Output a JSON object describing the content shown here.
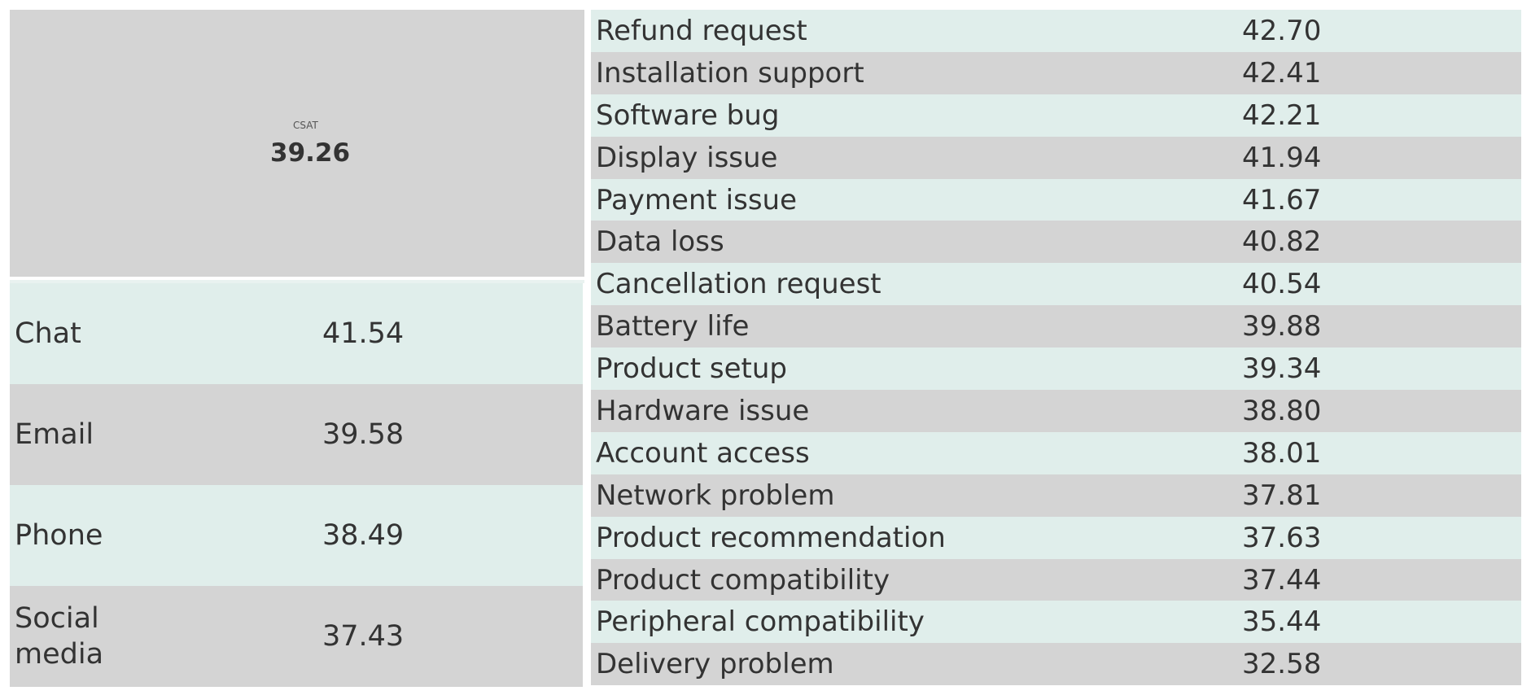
{
  "kpi": {
    "label": "CSAT",
    "value": "39.26"
  },
  "channels": [
    {
      "name": "Chat",
      "value": "41.54"
    },
    {
      "name": "Email",
      "value": "39.58"
    },
    {
      "name": "Phone",
      "value": "38.49"
    },
    {
      "name": "Social media",
      "value": "37.43"
    }
  ],
  "issues": [
    {
      "name": "Refund request",
      "value": "42.70"
    },
    {
      "name": "Installation support",
      "value": "42.41"
    },
    {
      "name": "Software bug",
      "value": "42.21"
    },
    {
      "name": "Display issue",
      "value": "41.94"
    },
    {
      "name": "Payment issue",
      "value": "41.67"
    },
    {
      "name": "Data loss",
      "value": "40.82"
    },
    {
      "name": "Cancellation request",
      "value": "40.54"
    },
    {
      "name": "Battery life",
      "value": "39.88"
    },
    {
      "name": "Product setup",
      "value": "39.34"
    },
    {
      "name": "Hardware issue",
      "value": "38.80"
    },
    {
      "name": "Account access",
      "value": "38.01"
    },
    {
      "name": "Network problem",
      "value": "37.81"
    },
    {
      "name": "Product recommendation",
      "value": "37.63"
    },
    {
      "name": "Product compatibility",
      "value": "37.44"
    },
    {
      "name": "Peripheral compatibility",
      "value": "35.44"
    },
    {
      "name": "Delivery problem",
      "value": "32.58"
    }
  ],
  "colors": {
    "row_teal": "#e0eeeb",
    "row_grey": "#d4d4d4",
    "text": "#333333"
  }
}
